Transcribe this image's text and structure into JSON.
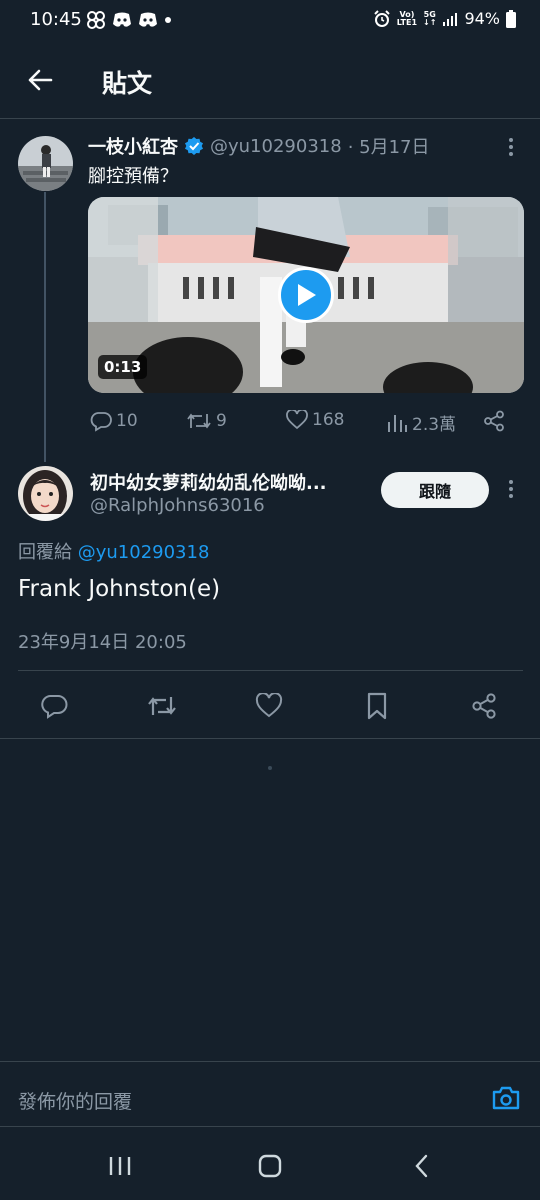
{
  "status_bar": {
    "time": "10:45",
    "network_top": "Vo)",
    "network_bottom": "LTE1",
    "gen": "5G",
    "battery": "94%"
  },
  "header": {
    "title": "貼文"
  },
  "parent_tweet": {
    "name": "一枝小紅杏",
    "handle": "@yu10290318",
    "date": "· 5月17日",
    "text": "腳控預備？",
    "video_duration": "0:13",
    "replies": "10",
    "retweets": "9",
    "likes": "168",
    "views": "2.3萬"
  },
  "reply_tweet": {
    "name": "初中幼女萝莉幼幼乱伦呦呦...",
    "handle": "@RalphJohns63016",
    "follow_label": "跟隨",
    "replying_prefix": "回覆給",
    "replying_to": "@yu10290318",
    "text": "Frank Johnston(e)",
    "timestamp": "23年9月14日 20:05"
  },
  "compose": {
    "placeholder": "發佈你的回覆"
  },
  "colors": {
    "background": "#15202b",
    "accent": "#1d9bf0",
    "muted": "#8b98a5",
    "verified": "#1d9bf0"
  }
}
